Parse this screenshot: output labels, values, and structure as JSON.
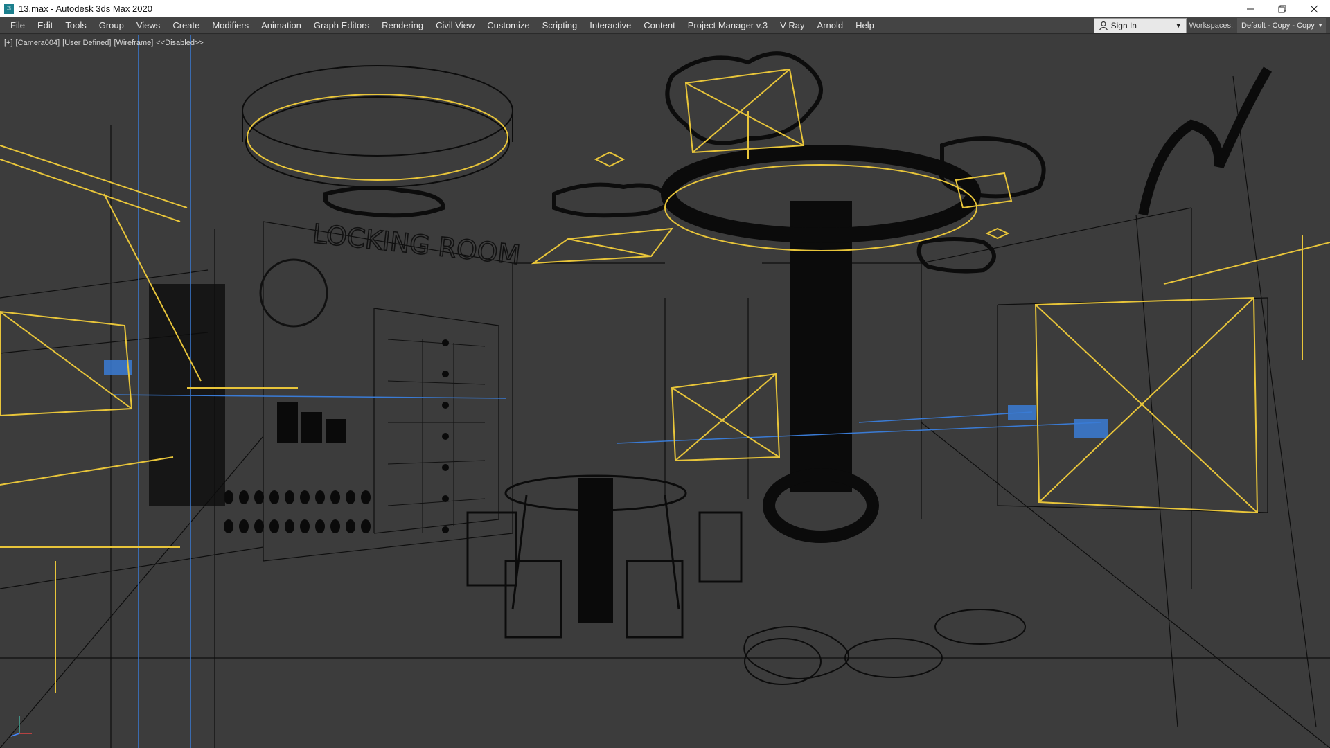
{
  "window": {
    "app_icon": "3ds-max-logo",
    "title": "13.max - Autodesk 3ds Max 2020",
    "minimize_icon": "minimize-icon",
    "restore_icon": "restore-icon",
    "close_icon": "close-icon"
  },
  "menubar": {
    "items": [
      "File",
      "Edit",
      "Tools",
      "Group",
      "Views",
      "Create",
      "Modifiers",
      "Animation",
      "Graph Editors",
      "Rendering",
      "Civil View",
      "Customize",
      "Scripting",
      "Interactive",
      "Content",
      "Project Manager v.3",
      "V-Ray",
      "Arnold",
      "Help"
    ],
    "sign_in": "Sign In",
    "workspaces_label": "Workspaces:",
    "workspaces_value": "Default - Copy - Copy"
  },
  "viewport": {
    "label_parts": [
      "[+]",
      "[Camera004]",
      "[User Defined]",
      "[Wireframe]",
      "<<Disabled>>"
    ],
    "scene_text": "LOCKING ROOM"
  },
  "colors": {
    "light_yellow": "#e8c53a",
    "camera_blue": "#3a7bd5",
    "wire_black": "#0b0b0b",
    "viewport_bg": "#3c3c3c"
  }
}
